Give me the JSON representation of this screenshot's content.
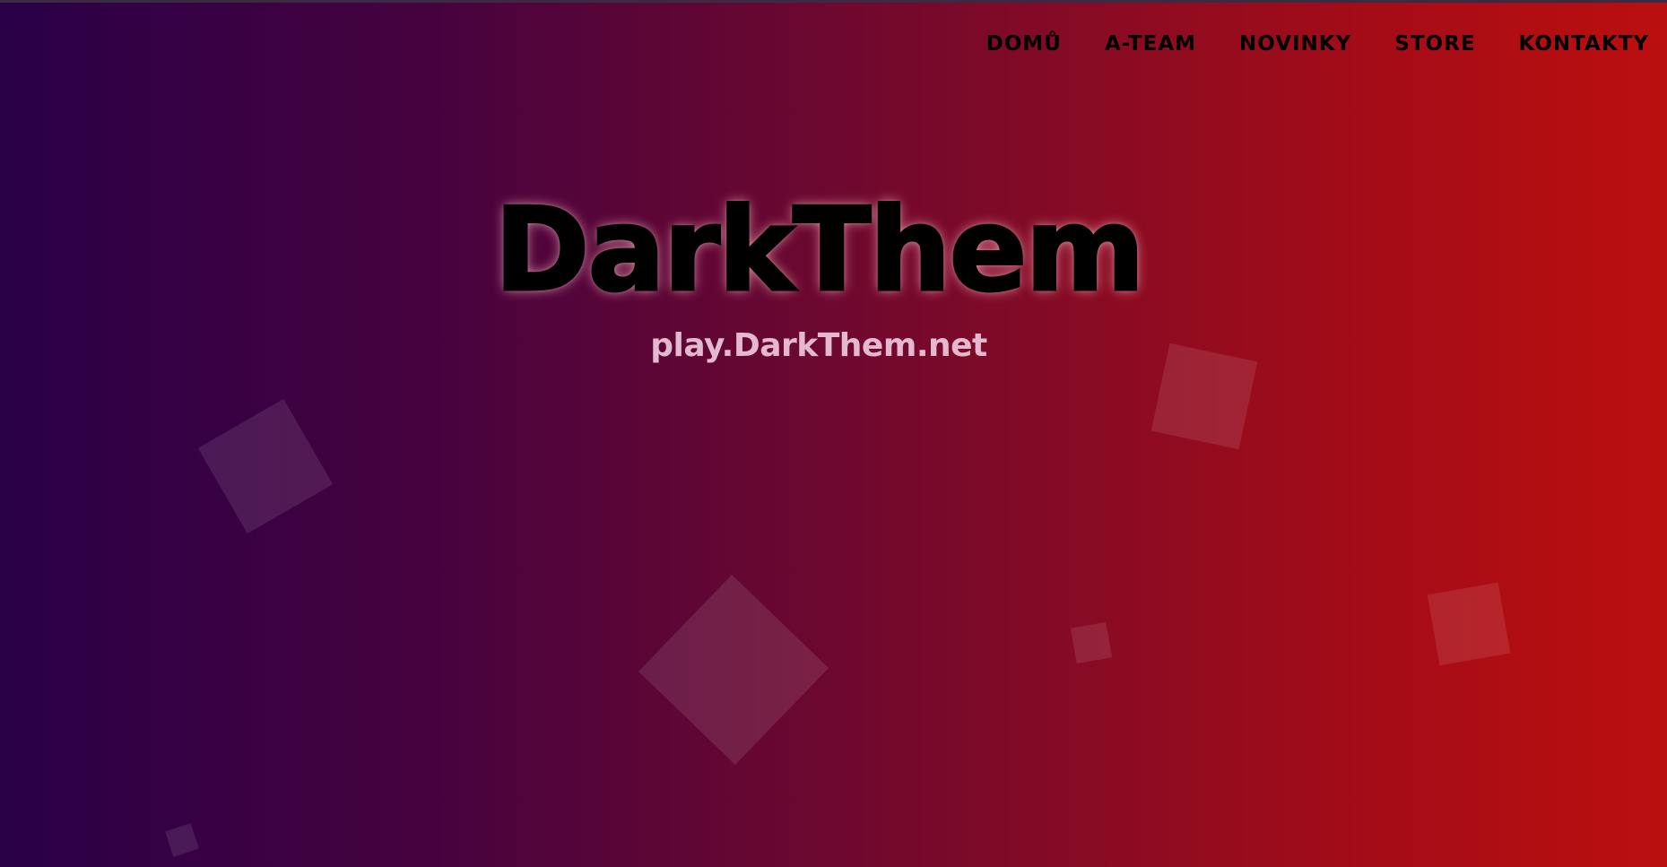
{
  "nav": {
    "items": [
      {
        "label": "DOMŮ"
      },
      {
        "label": "A-TEAM"
      },
      {
        "label": "NOVINKY"
      },
      {
        "label": "STORE"
      },
      {
        "label": "KONTAKTY"
      }
    ]
  },
  "hero": {
    "title": "DarkThem",
    "subtitle": "play.DarkThem.net"
  },
  "colors": {
    "gradient_start": "#2a0047",
    "gradient_end": "#bb0f0f",
    "subtitle_color": "#e4b9cf",
    "nav_text": "#000000"
  }
}
